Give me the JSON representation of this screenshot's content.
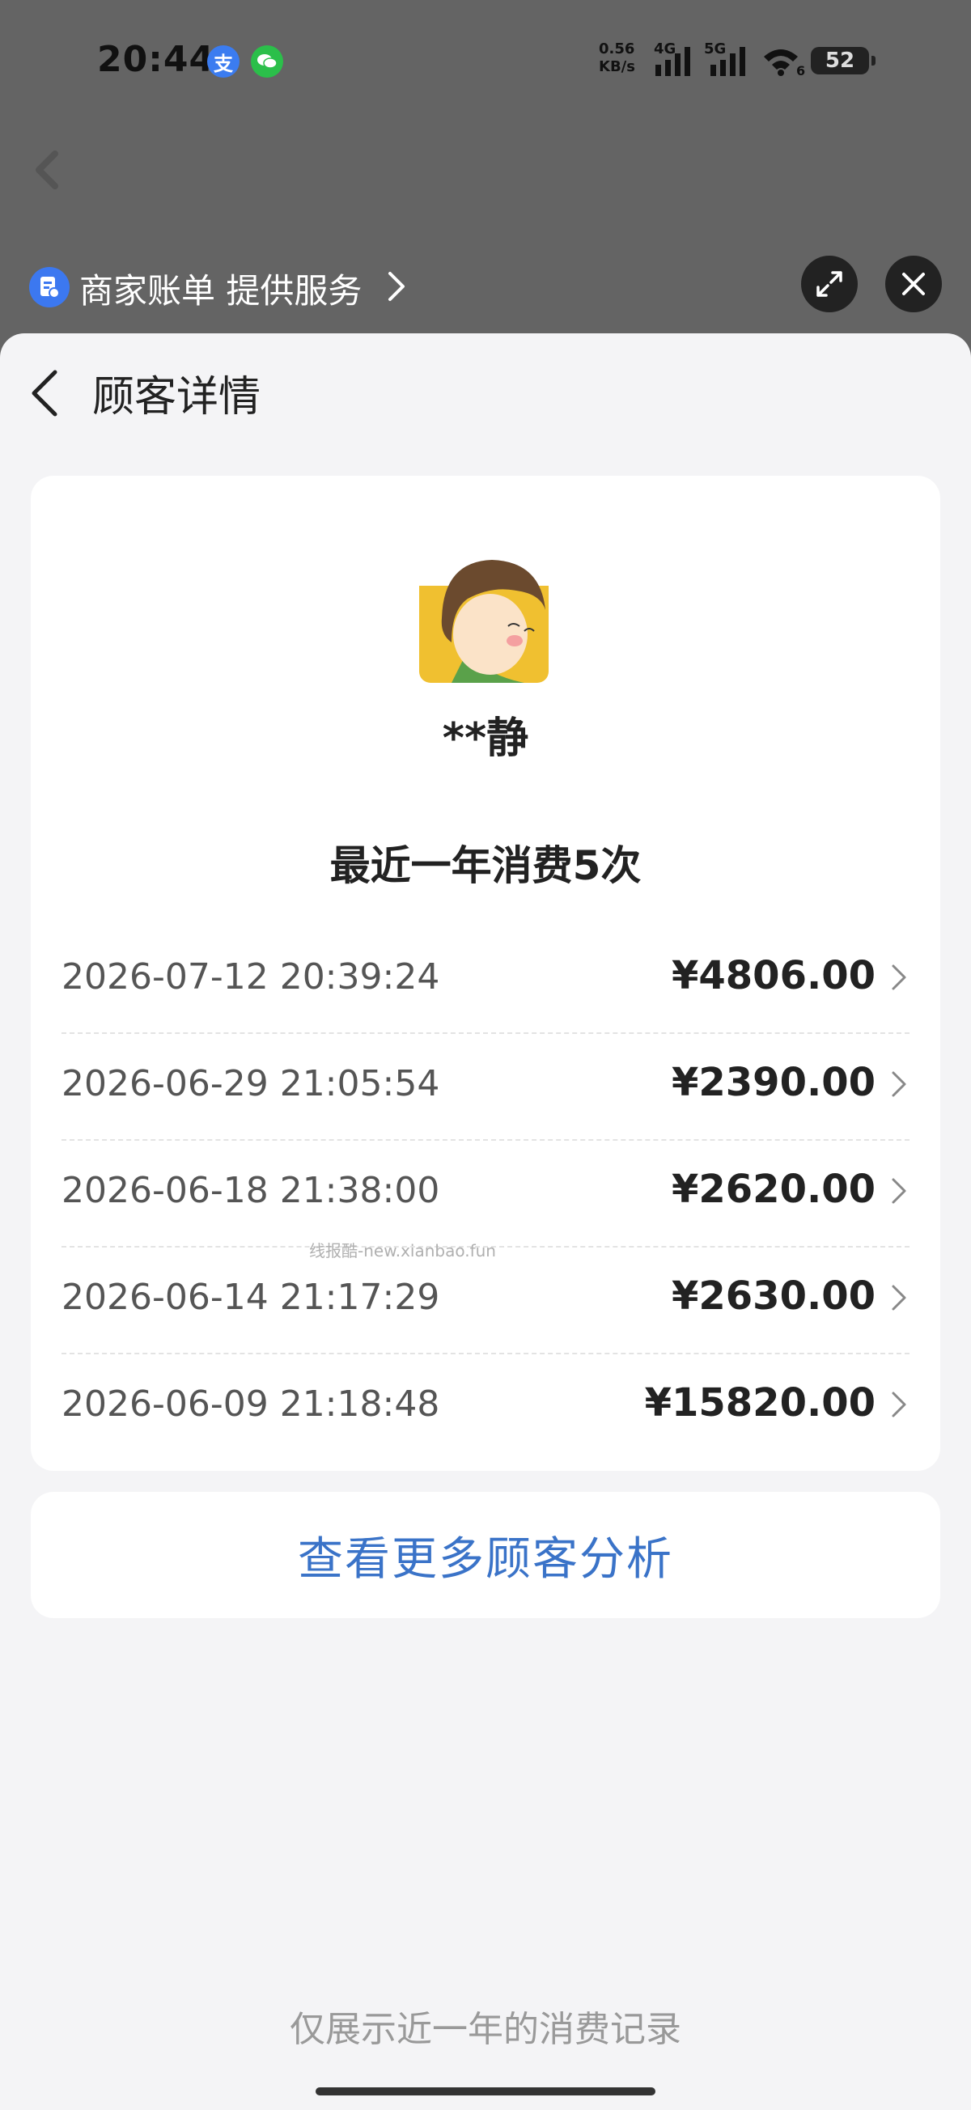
{
  "status_bar": {
    "time": "20:44",
    "net_speed": "0.56",
    "net_unit": "KB/s",
    "net_4g": "4G",
    "net_5g": "5G",
    "wifi_num": "6",
    "battery": "52",
    "apps": [
      "alipay-icon",
      "wechat-icon"
    ]
  },
  "mini_app": {
    "service_label": "商家账单 提供服务"
  },
  "nav": {
    "title": "顾客详情"
  },
  "customer": {
    "name": "**静",
    "summary": "最近一年消费5次"
  },
  "records": [
    {
      "date": "2026-07-12 20:39:24",
      "amount": "¥4806.00"
    },
    {
      "date": "2026-06-29 21:05:54",
      "amount": "¥2390.00"
    },
    {
      "date": "2026-06-18 21:38:00",
      "amount": "¥2620.00"
    },
    {
      "date": "2026-06-14 21:17:29",
      "amount": "¥2630.00"
    },
    {
      "date": "2026-06-09 21:18:48",
      "amount": "¥15820.00"
    }
  ],
  "watermark": "线报酷-new.xianbao.fun",
  "more_link": "查看更多顾客分析",
  "footer_note": "仅展示近一年的消费记录",
  "colors": {
    "link": "#3a73c8",
    "overlay": "#646464",
    "sheet_bg": "#f4f4f6"
  }
}
